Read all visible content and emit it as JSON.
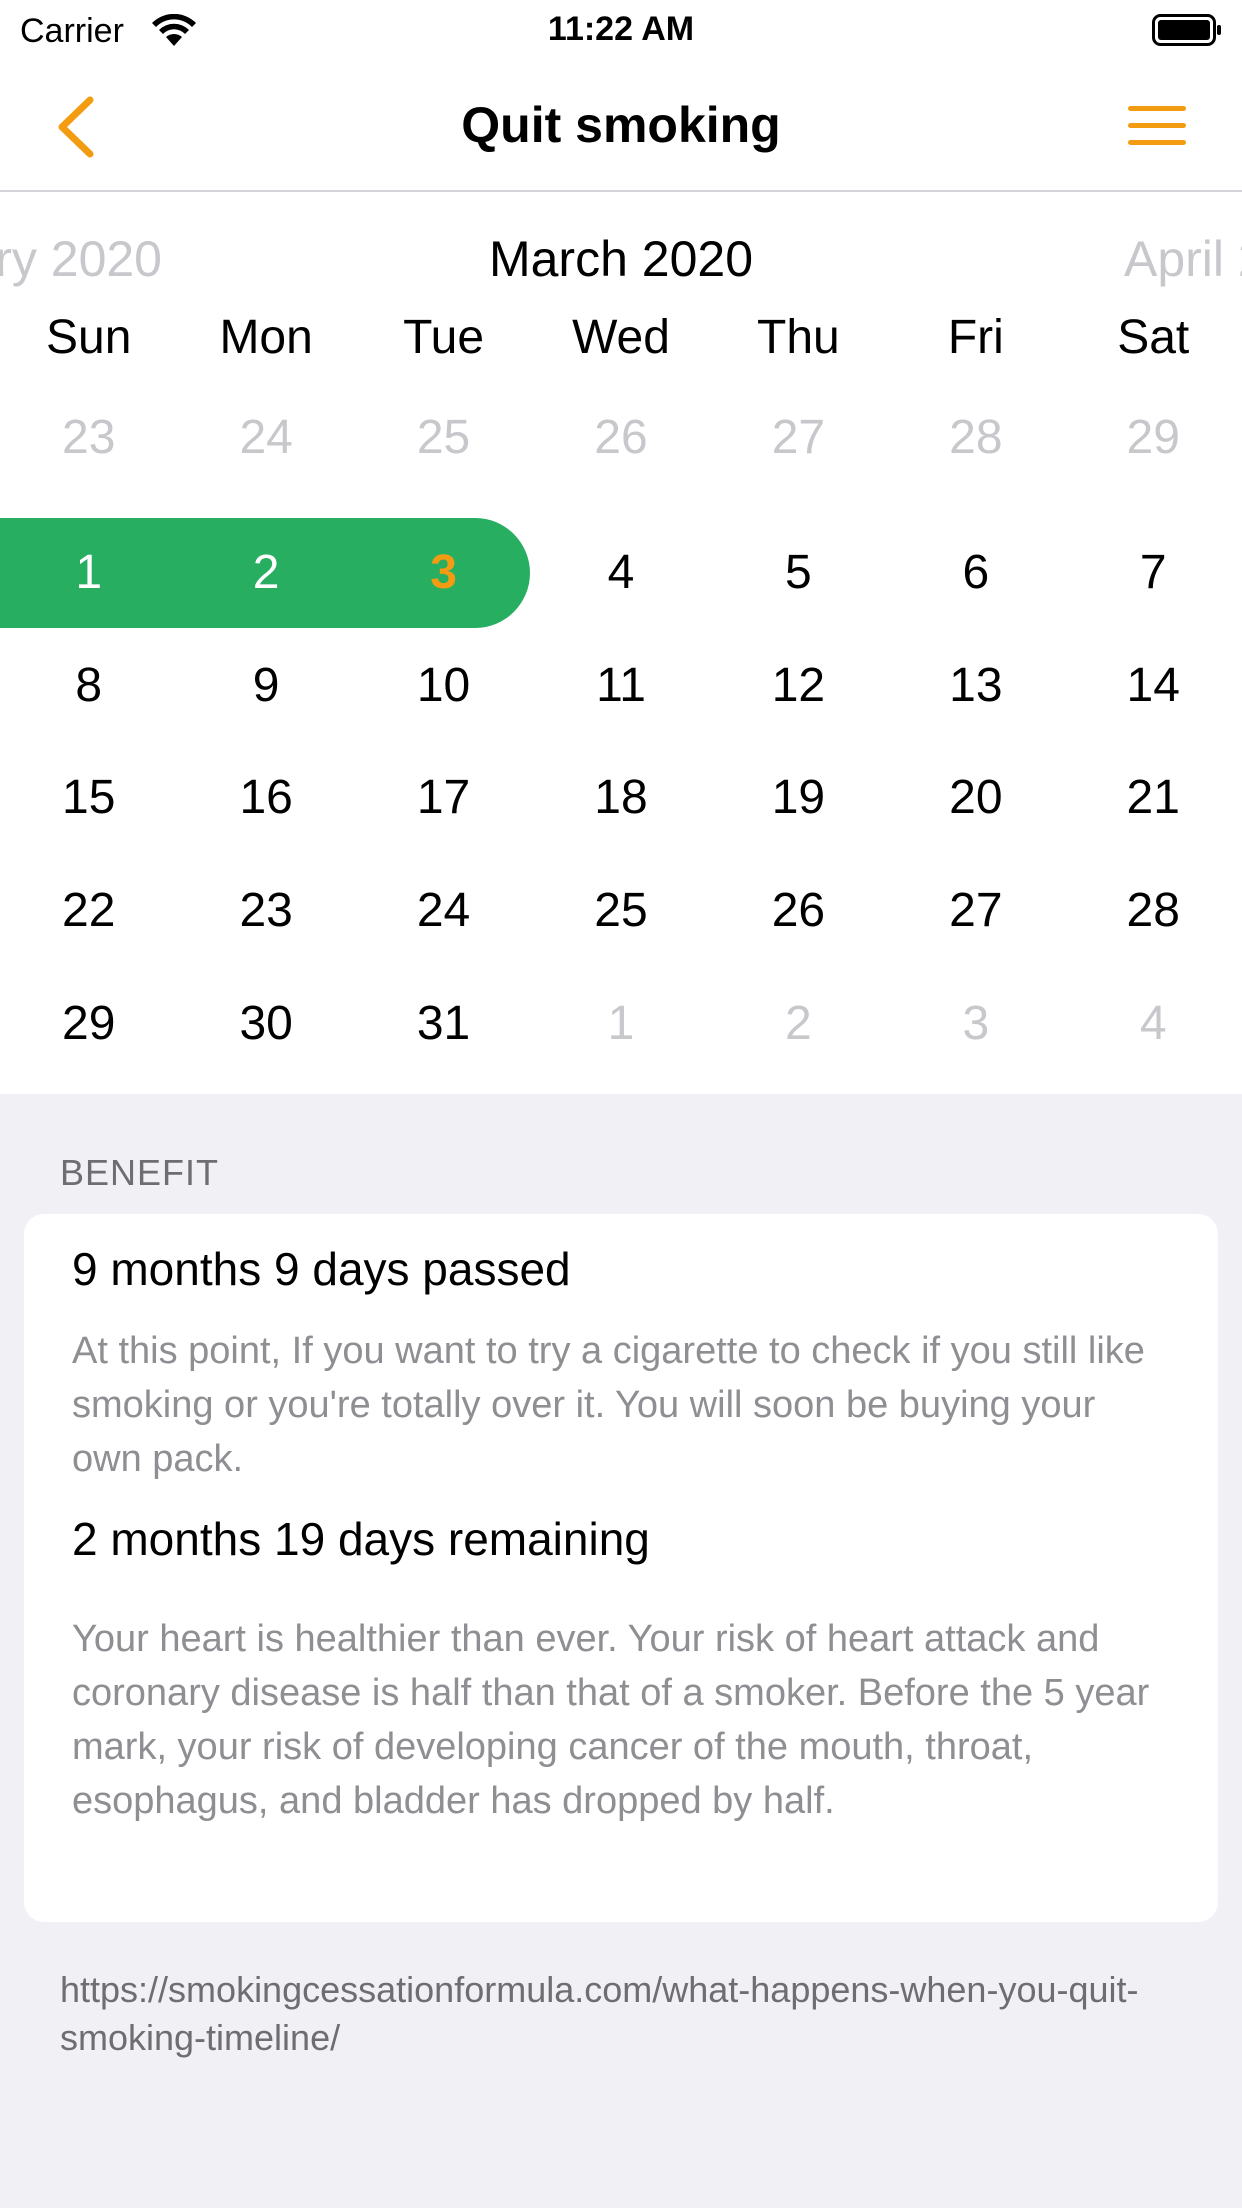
{
  "status_bar": {
    "carrier": "Carrier",
    "time": "11:22 AM"
  },
  "nav": {
    "title": "Quit smoking",
    "back_icon": "chevron-left-icon",
    "menu_icon": "hamburger-menu-icon"
  },
  "accent_color": "#f39c12",
  "selection_color": "#27ae60",
  "calendar": {
    "prev_month": "ry 2020",
    "current_month": "March 2020",
    "next_month": "April 2",
    "weekdays": [
      "Sun",
      "Mon",
      "Tue",
      "Wed",
      "Thu",
      "Fri",
      "Sat"
    ],
    "weeks": [
      [
        "23",
        "24",
        "25",
        "26",
        "27",
        "28",
        "29"
      ],
      [
        "1",
        "2",
        "3",
        "4",
        "5",
        "6",
        "7"
      ],
      [
        "8",
        "9",
        "10",
        "11",
        "12",
        "13",
        "14"
      ],
      [
        "15",
        "16",
        "17",
        "18",
        "19",
        "20",
        "21"
      ],
      [
        "22",
        "23",
        "24",
        "25",
        "26",
        "27",
        "28"
      ],
      [
        "29",
        "30",
        "31",
        "1",
        "2",
        "3",
        "4"
      ]
    ]
  },
  "benefit": {
    "header": "BENEFIT",
    "passed_title": "9 months 9 days passed",
    "passed_text": "At this point, If you want to try a cigarette to check if you still like smoking or you're totally over it. You will soon be buying your own pack.",
    "remaining_title": "2 months 19 days remaining",
    "remaining_text": "Your heart is healthier than ever. Your risk of heart attack and coronary disease is half than that of a smoker. Before the 5 year mark, your risk of developing cancer of the mouth, throat, esophagus, and bladder has dropped by half.",
    "source": "https://smokingcessationformula.com/what-happens-when-you-quit-smoking-timeline/"
  }
}
